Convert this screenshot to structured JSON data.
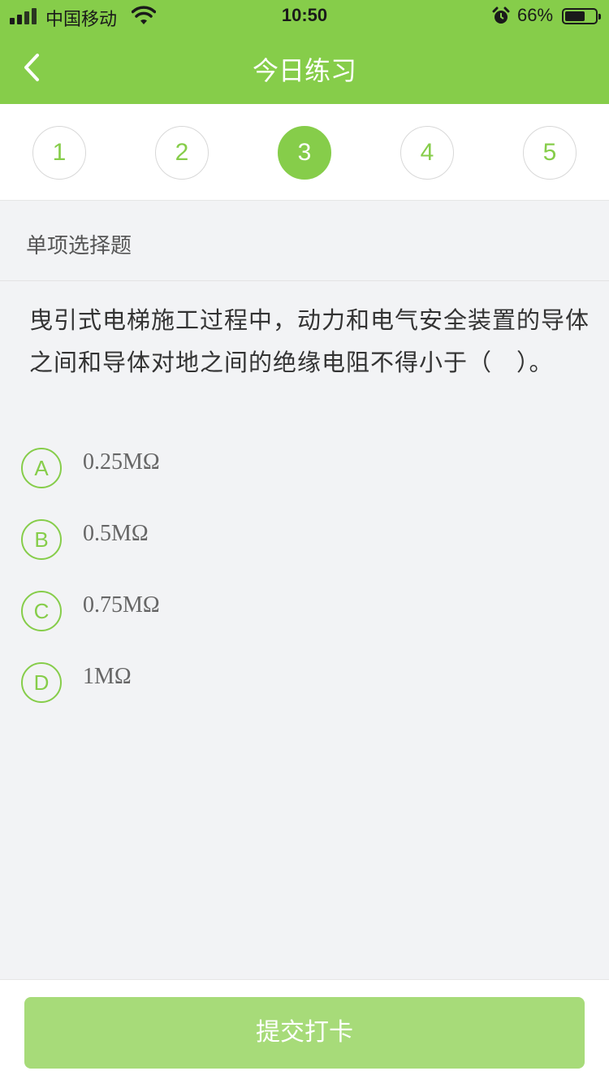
{
  "status_bar": {
    "carrier": "中国移动",
    "time": "10:50",
    "battery": "66%",
    "battery_level": 0.66
  },
  "nav": {
    "title": "今日练习",
    "back_icon": "chevron-left-icon"
  },
  "steps": [
    "1",
    "2",
    "3",
    "4",
    "5"
  ],
  "current_step": 3,
  "question": {
    "type": "单项选择题",
    "text": "曳引式电梯施工过程中，动力和电气安全装置的导体之间和导体对地之间的绝缘电阻不得小于（　）。",
    "options": [
      {
        "letter": "A",
        "text": "0.25MΩ"
      },
      {
        "letter": "B",
        "text": "0.5MΩ"
      },
      {
        "letter": "C",
        "text": "0.75MΩ"
      },
      {
        "letter": "D",
        "text": "1MΩ"
      }
    ]
  },
  "footer": {
    "submit_label": "提交打卡"
  },
  "colors": {
    "accent": "#86cd4a",
    "submit_disabled": "#a7db79",
    "background": "#f2f3f5"
  }
}
